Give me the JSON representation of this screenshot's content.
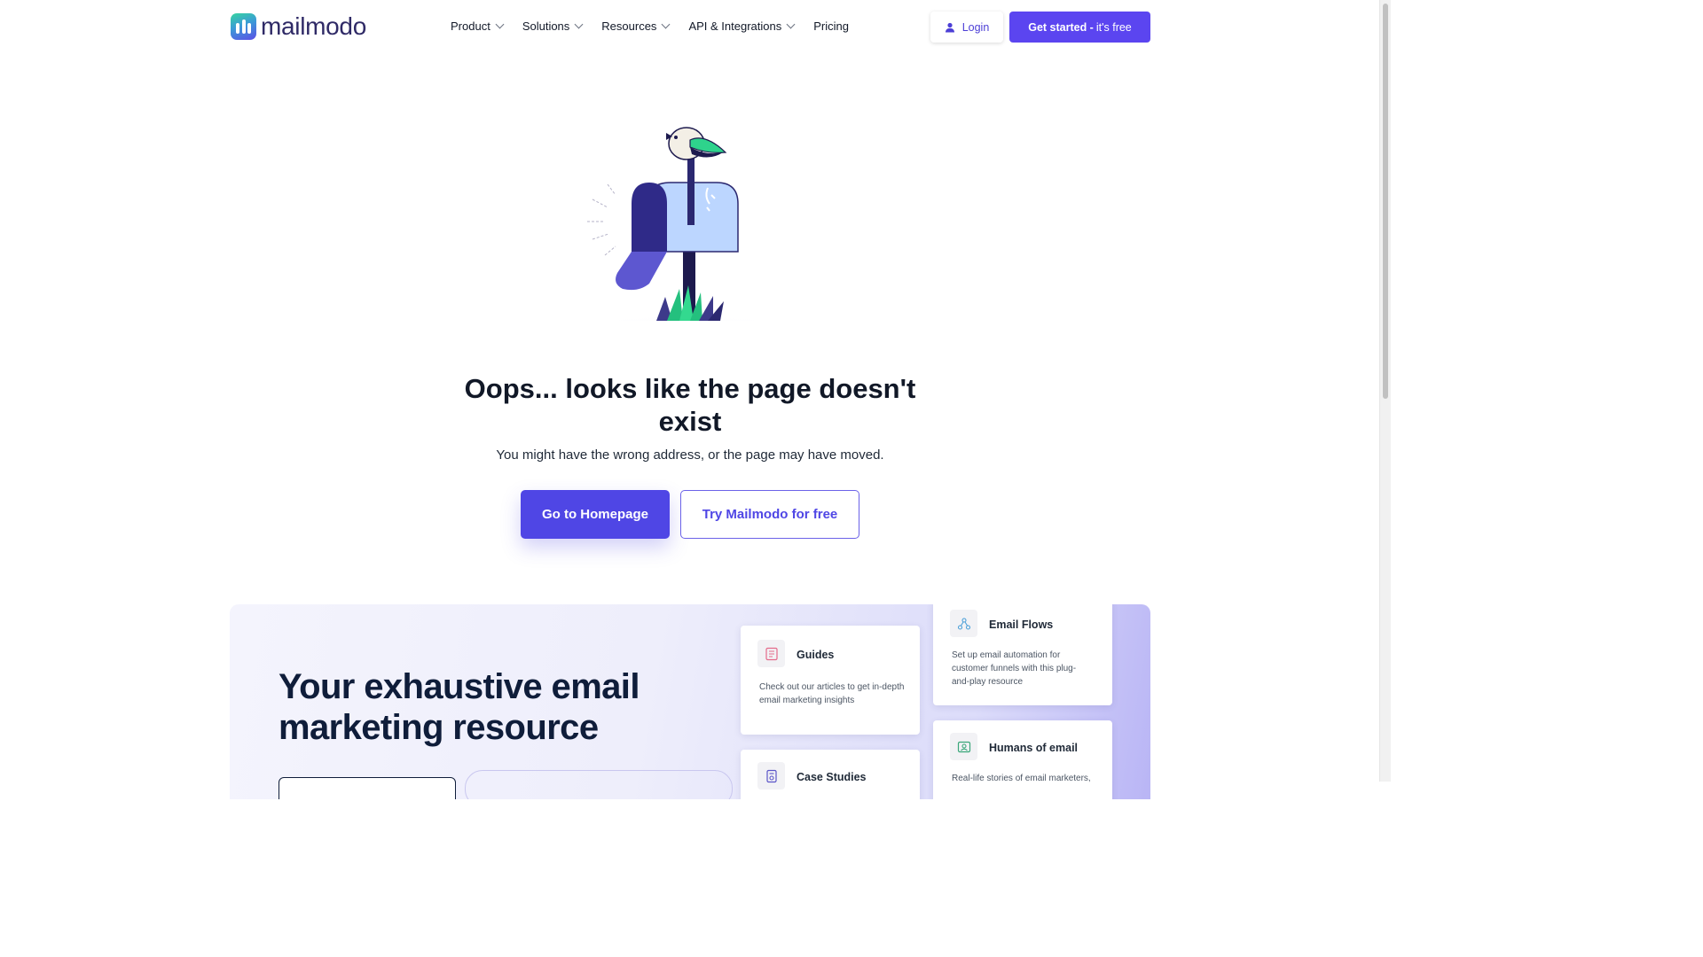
{
  "header": {
    "logo_text": "mailmodo",
    "nav": [
      {
        "label": "Product",
        "has_dropdown": true
      },
      {
        "label": "Solutions",
        "has_dropdown": true
      },
      {
        "label": "Resources",
        "has_dropdown": true
      },
      {
        "label": "API & Integrations",
        "has_dropdown": true
      },
      {
        "label": "Pricing",
        "has_dropdown": false
      }
    ],
    "login_label": "Login",
    "cta_bold": "Get started -",
    "cta_light": "it's free"
  },
  "hero": {
    "headline": "Oops... looks like the page doesn't exist",
    "subtext": "You might have the wrong address, or the page may have moved.",
    "primary_button": "Go to Homepage",
    "secondary_button": "Try Mailmodo for free"
  },
  "resources": {
    "title": "Your exhaustive email marketing resource",
    "cards": [
      {
        "title": "Guides",
        "desc": "Check out our articles to get in-depth email marketing insights",
        "icon": "document-icon"
      },
      {
        "title": "Email Flows",
        "desc": "Set up email automation for customer funnels with this plug-and-play resource",
        "icon": "flow-icon"
      },
      {
        "title": "Case Studies",
        "desc": "",
        "icon": "case-study-icon"
      },
      {
        "title": "Humans of email",
        "desc": "Real-life stories of email marketers,",
        "icon": "person-card-icon"
      }
    ]
  },
  "colors": {
    "primary": "#4f46e5",
    "cta": "#5b45f0",
    "heading": "#0f1d3a"
  }
}
